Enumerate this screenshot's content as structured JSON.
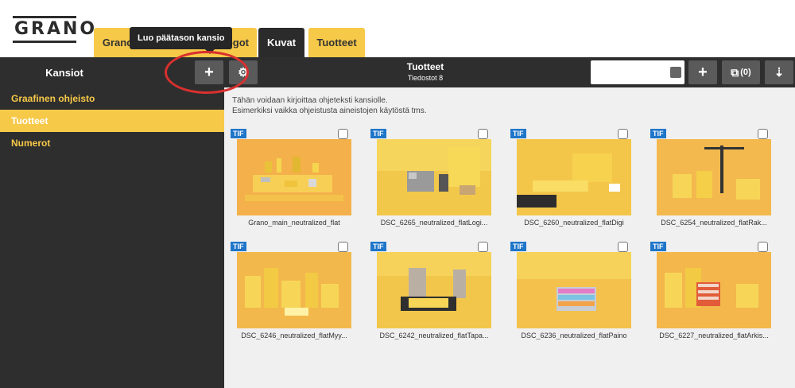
{
  "logo": "GRANO",
  "tabs": [
    {
      "label": "Grano",
      "active": false
    },
    {
      "label": "Logot",
      "active": false
    },
    {
      "label": "Kuvat",
      "active": true
    },
    {
      "label": "Tuotteet",
      "active": false
    }
  ],
  "tooltip": "Luo päätason kansio",
  "toolbar": {
    "folders_title": "Kansiot",
    "add_icon": "plus-icon",
    "settings_icon": "gear-icon",
    "current_folder": "Tuotteet",
    "files_count": "Tiedostot 8",
    "search_placeholder": "",
    "add_button_icon": "plus-icon",
    "selection_label": "(0)",
    "sort_icon": "sort-icon"
  },
  "sidebar": {
    "items": [
      {
        "label": "Graafinen ohjeisto",
        "active": false
      },
      {
        "label": "Tuotteet",
        "active": true
      },
      {
        "label": "Numerot",
        "active": false
      }
    ]
  },
  "main": {
    "help_line1": "Tähän voidaan kirjoittaa ohjeteksti kansiolle.",
    "help_line2": "Esimerkiksi vaikka ohjeistusta aineistojen käytöstä tms.",
    "files": [
      {
        "type": "TIF",
        "name": "Grano_main_neutralized_flat"
      },
      {
        "type": "TIF",
        "name": "DSC_6265_neutralized_flatLogi..."
      },
      {
        "type": "TIF",
        "name": "DSC_6260_neutralized_flatDigi"
      },
      {
        "type": "TIF",
        "name": "DSC_6254_neutralized_flatRak..."
      },
      {
        "type": "TIF",
        "name": "DSC_6246_neutralized_flatMyy..."
      },
      {
        "type": "TIF",
        "name": "DSC_6242_neutralized_flatTapa..."
      },
      {
        "type": "TIF",
        "name": "DSC_6236_neutralized_flatPaino"
      },
      {
        "type": "TIF",
        "name": "DSC_6227_neutralized_flatArkis..."
      }
    ]
  },
  "colors": {
    "accent": "#f7c948",
    "dark": "#2e2e2e",
    "badge": "#1f76c9",
    "highlight_ring": "#d8302f"
  }
}
